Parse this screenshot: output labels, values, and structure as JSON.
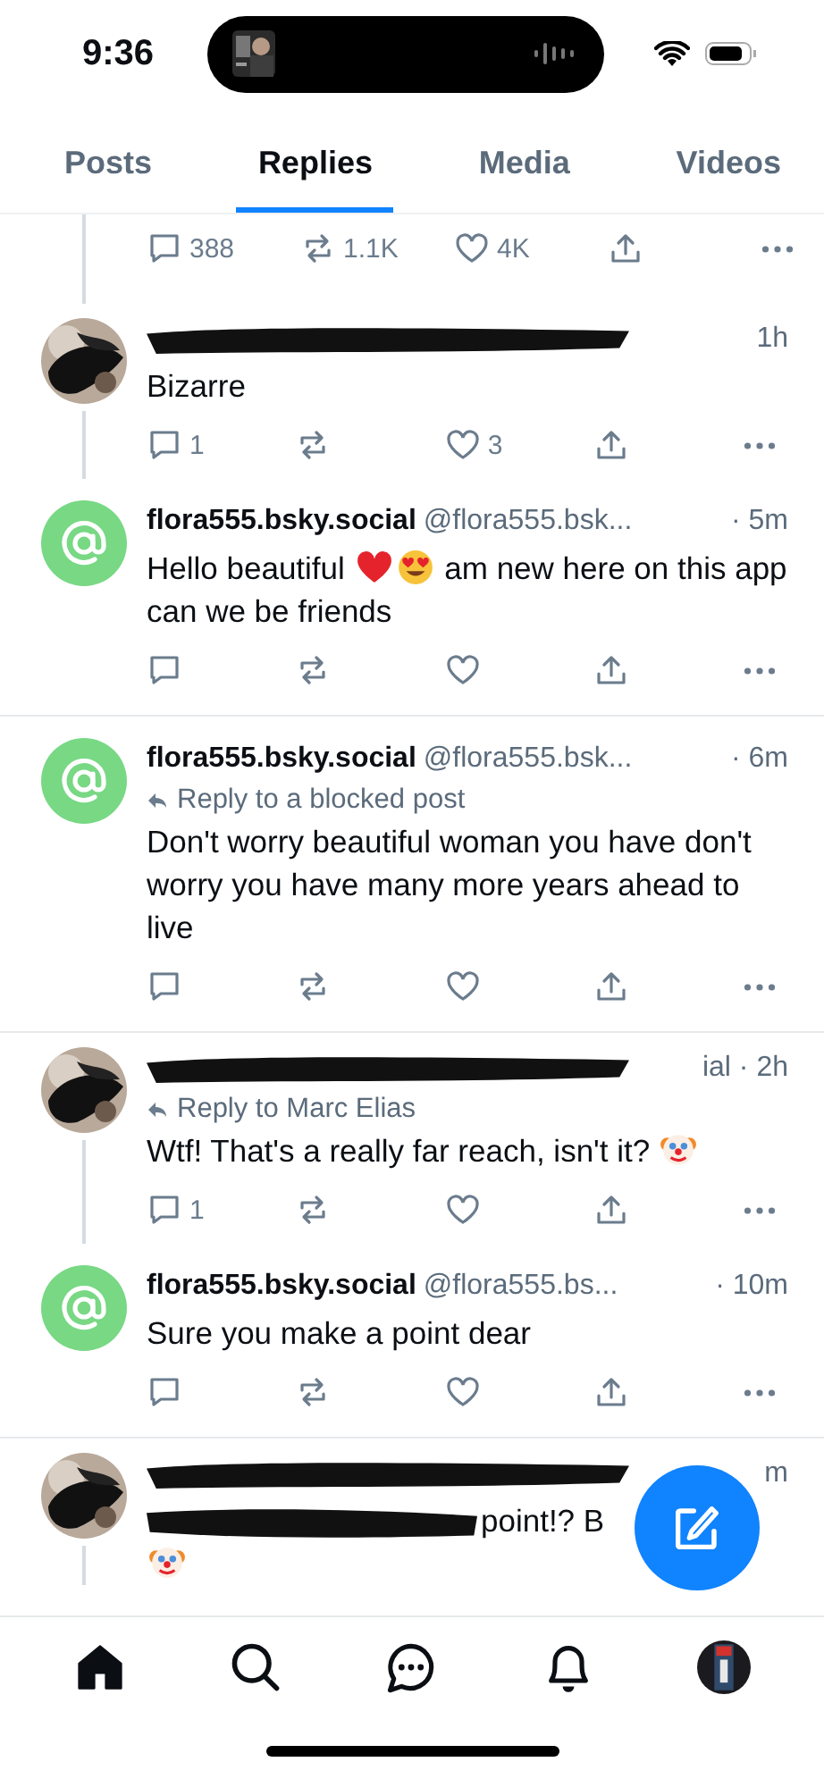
{
  "status_bar": {
    "time": "9:36"
  },
  "tabs": [
    {
      "label": "Posts",
      "selected": false
    },
    {
      "label": "Replies",
      "selected": true
    },
    {
      "label": "Media",
      "selected": false
    },
    {
      "label": "Videos",
      "selected": false
    }
  ],
  "top_actions": {
    "reply": "388",
    "repost": "1.1K",
    "like": "4K"
  },
  "posts": [
    {
      "kind": "redacted",
      "meta": "1h",
      "connected_below": true,
      "body": [
        {
          "kind": "text",
          "text": "Bizarre"
        }
      ],
      "reply_count": "1",
      "like_count": "3"
    },
    {
      "kind": "normal",
      "name": "flora555.bsky.social",
      "handle": "@flora555.bsk...",
      "time": "· 5m",
      "connected_below": false,
      "body": [
        {
          "kind": "text",
          "text": "Hello beautiful "
        },
        {
          "kind": "heart"
        },
        {
          "kind": "heart-eyes"
        },
        {
          "kind": "text",
          "text": " am new here on this app can we be friends"
        }
      ]
    },
    {
      "kind": "normal",
      "name": "flora555.bsky.social",
      "handle": "@flora555.bsk...",
      "time": "· 6m",
      "reply_to": "Reply to a blocked post",
      "connected_below": false,
      "body": [
        {
          "kind": "text",
          "text": "Don't worry beautiful woman you have don't worry you have many more years ahead to live"
        }
      ]
    },
    {
      "kind": "redacted",
      "meta": "ial · 2h",
      "reply_to": "Reply to Marc Elias",
      "connected_below": true,
      "body": [
        {
          "kind": "text",
          "text": "Wtf! That's a really far reach, isn't it? "
        },
        {
          "kind": "clown"
        }
      ],
      "reply_count": "1"
    },
    {
      "kind": "normal",
      "name": "flora555.bsky.social",
      "handle": "@flora555.bs...",
      "time": "· 10m",
      "connected_below": false,
      "body": [
        {
          "kind": "text",
          "text": "Sure you make a point dear"
        }
      ]
    },
    {
      "kind": "redacted",
      "meta": "m",
      "connected_below": true,
      "body": [
        {
          "kind": "scribble"
        },
        {
          "kind": "text",
          "text": "point!? B"
        },
        {
          "kind": "break"
        },
        {
          "kind": "clown"
        }
      ]
    }
  ]
}
